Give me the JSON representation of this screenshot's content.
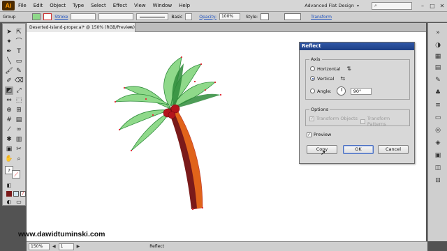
{
  "menubar": {
    "logo": "Ai",
    "items": [
      "File",
      "Edit",
      "Object",
      "Type",
      "Select",
      "Effect",
      "View",
      "Window",
      "Help"
    ],
    "workspace": "Advanced Flat Design",
    "workspace_arrow": "▾",
    "search_icon": "search-icon",
    "window_buttons": [
      "–",
      "□",
      "✕"
    ]
  },
  "controlbar": {
    "selection_label": "Group",
    "stroke_label": "Stroke",
    "stroke_style": "Basic",
    "opacity_label": "Opacity:",
    "opacity_value": "100%",
    "style_label": "Style:",
    "transform_label": "Transform"
  },
  "document": {
    "tab_title": "Deserted-Island-proper.ai* @ 150% (RGB/Preview)",
    "close": "✕"
  },
  "statusbar": {
    "zoom": "150%",
    "artboard": "1",
    "status_text": "Reflect",
    "prev": "◀",
    "next": "▶"
  },
  "watermark": "www.dawidtuminski.com",
  "dialog": {
    "title": "Reflect",
    "axis_group": "Axis",
    "horizontal": "Horizontal",
    "vertical": "Vertical",
    "angle_label": "Angle:",
    "angle_value": "90°",
    "options_group": "Options",
    "transform_objects": "Transform Objects",
    "transform_patterns": "Transform Patterns",
    "preview": "Preview",
    "copy_button": "Copy",
    "ok_button": "OK",
    "cancel_button": "Cancel",
    "selected_axis": "vertical",
    "preview_checked": true
  },
  "colors": {
    "leaf_light": "#8fd98a",
    "leaf_dark": "#2e8b3a",
    "trunk_dark": "#7a1a1a",
    "trunk_orange": "#e0631a",
    "coconut": "#b3141c",
    "selection": "#e0303a"
  }
}
